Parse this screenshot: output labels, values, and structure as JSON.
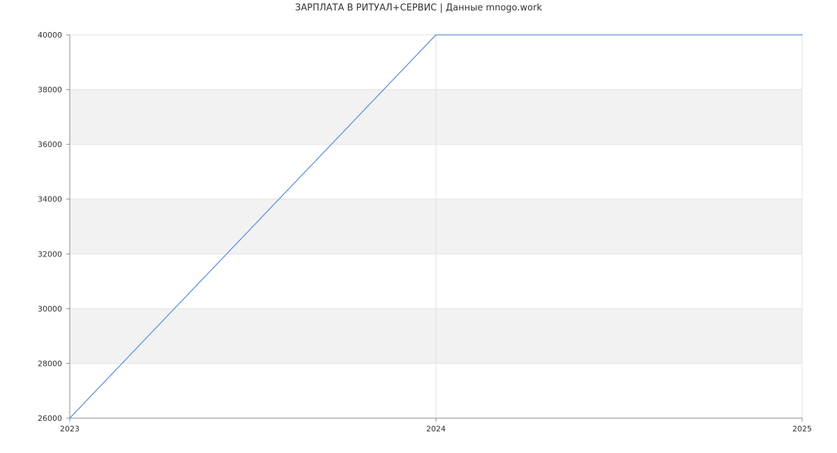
{
  "chart_data": {
    "type": "line",
    "title": "ЗАРПЛАТА В РИТУАЛ+СЕРВИС | Данные mnogo.work",
    "xlabel": "",
    "ylabel": "",
    "x": [
      "2023",
      "2024",
      "2025"
    ],
    "series": [
      {
        "values": [
          26000,
          40000,
          40000
        ]
      }
    ],
    "ylim": [
      26000,
      40000
    ],
    "yticks": [
      26000,
      28000,
      30000,
      32000,
      34000,
      36000,
      38000,
      40000
    ],
    "grid": true,
    "legend": "none",
    "colors": {
      "line": "#5b8fdf",
      "band": "#f2f2f2",
      "grid": "#e0e0e0",
      "axis": "#888888"
    }
  }
}
